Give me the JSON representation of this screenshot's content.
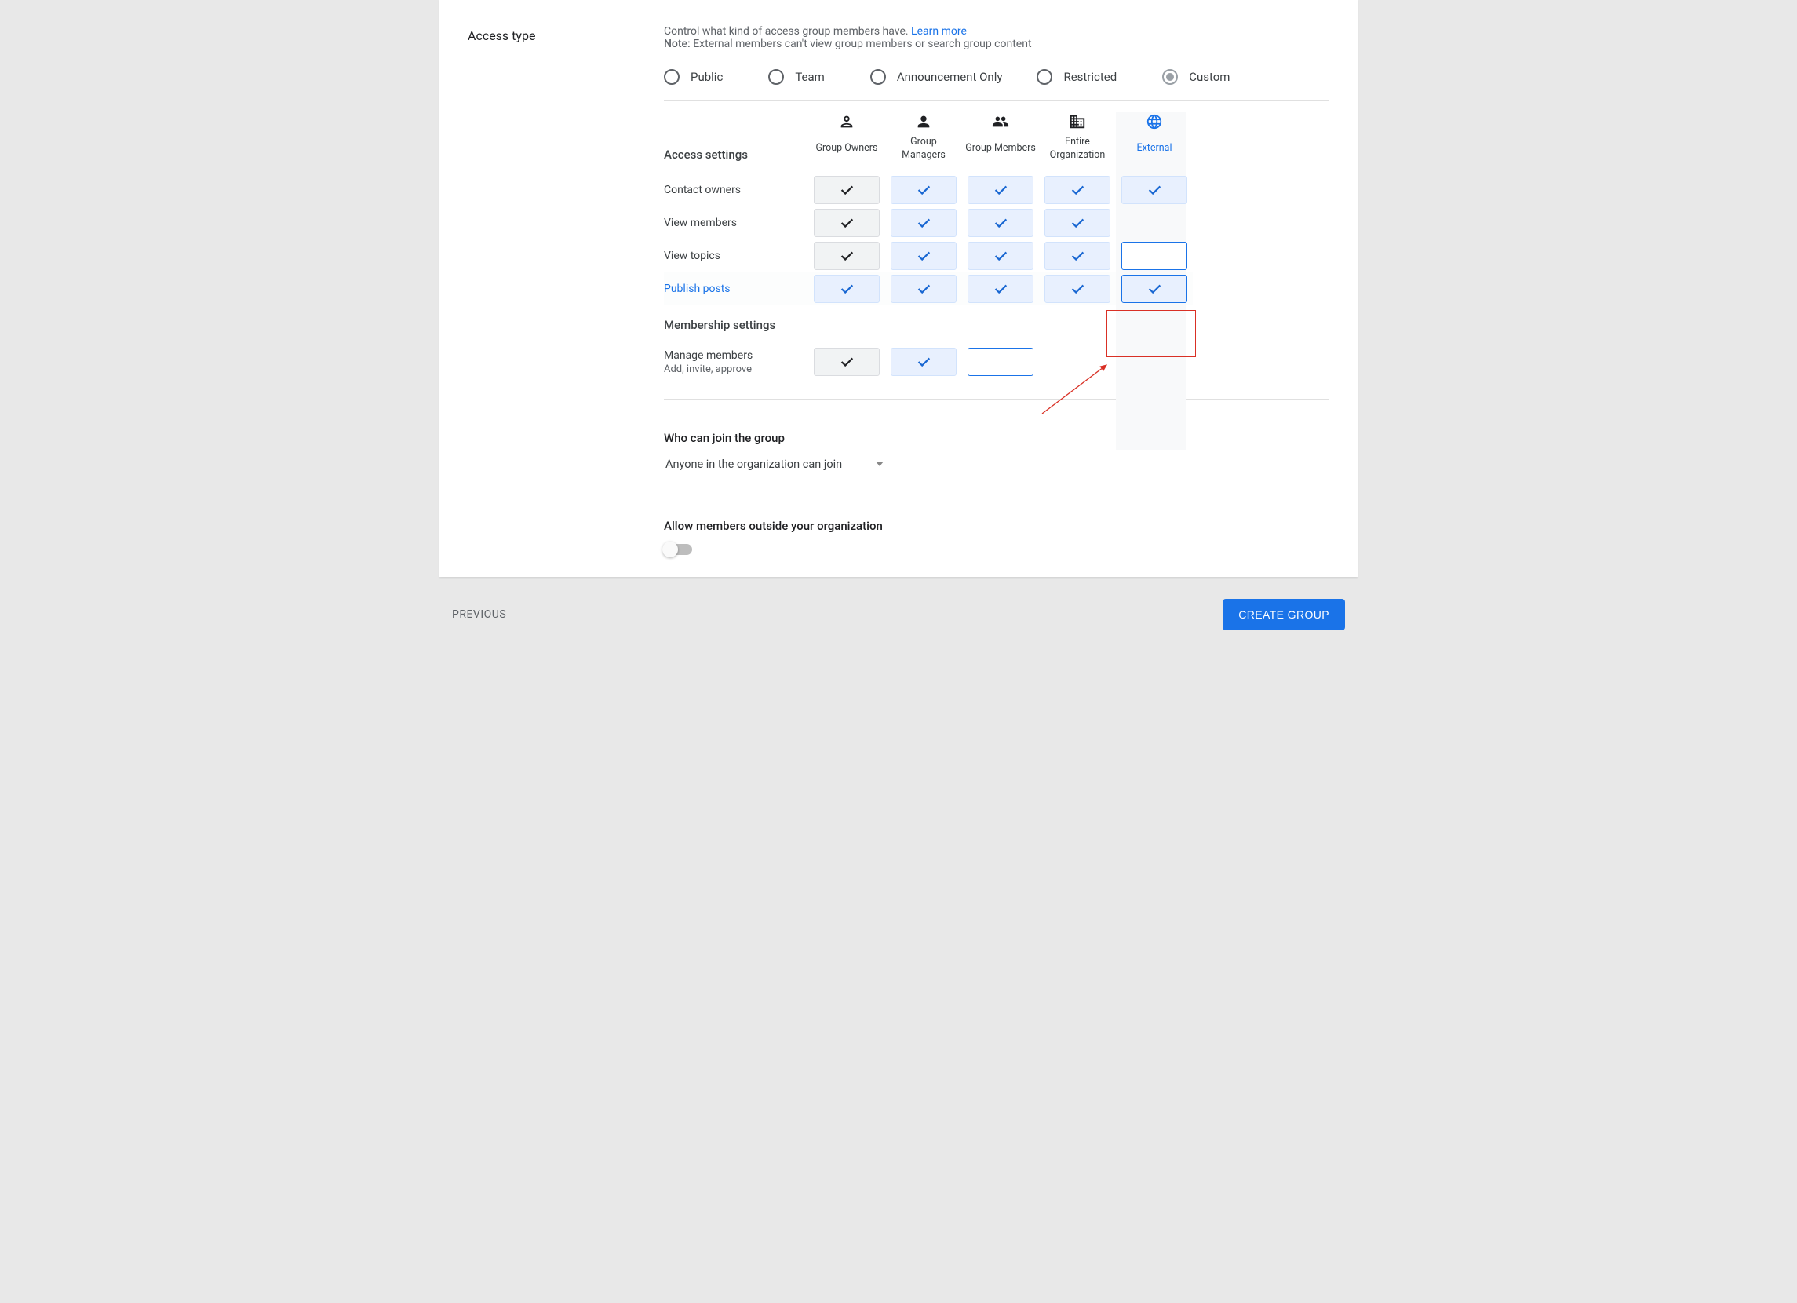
{
  "header": {
    "title": "Access type",
    "description": "Control what kind of access group members have.",
    "learn_more": "Learn more",
    "note_label": "Note:",
    "note_text": "External members can't view group members or search group content"
  },
  "radios": {
    "public": "Public",
    "team": "Team",
    "announcement": "Announcement Only",
    "restricted": "Restricted",
    "custom": "Custom"
  },
  "columns": {
    "owners": "Group Owners",
    "managers": "Group Managers",
    "members": "Group Members",
    "org": "Entire Organization",
    "external": "External"
  },
  "sections": {
    "access": "Access settings",
    "membership": "Membership settings"
  },
  "rows": {
    "contact": "Contact owners",
    "view_members": "View members",
    "view_topics": "View topics",
    "publish": "Publish posts",
    "manage_members": "Manage members",
    "manage_members_sub": "Add, invite, approve"
  },
  "join": {
    "title": "Who can join the group",
    "value": "Anyone in the organization can join"
  },
  "allow": {
    "title": "Allow members outside your organization"
  },
  "footer": {
    "previous": "PREVIOUS",
    "create": "CREATE GROUP"
  }
}
